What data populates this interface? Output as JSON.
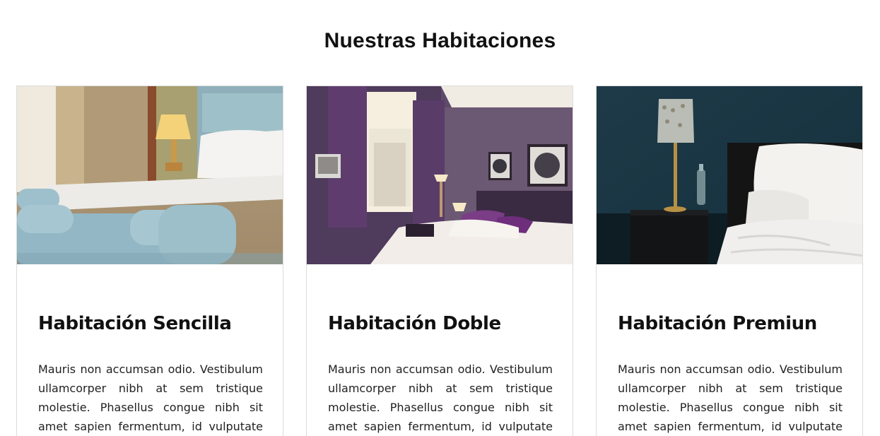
{
  "section": {
    "title": "Nuestras Habitaciones"
  },
  "rooms": [
    {
      "title": "Habitación Sencilla",
      "description": "Mauris non accumsan odio. Vestibulum ullamcorper nibh at sem tristique molestie. Phasellus congue nibh sit amet sapien fermentum, id vulputate erat",
      "image_alt": "single-room-photo"
    },
    {
      "title": "Habitación Doble",
      "description": "Mauris non accumsan odio. Vestibulum ullamcorper nibh at sem tristique molestie. Phasellus congue nibh sit amet sapien fermentum, id vulputate erat",
      "image_alt": "double-room-photo"
    },
    {
      "title": "Habitación Premiun",
      "description": "Mauris non accumsan odio. Vestibulum ullamcorper nibh at sem tristique molestie. Phasellus congue nibh sit amet sapien fermentum, id vulputate erat",
      "image_alt": "premium-room-photo"
    }
  ],
  "colors": {
    "text": "#111111",
    "border": "#dcdcdc",
    "background": "#ffffff"
  }
}
